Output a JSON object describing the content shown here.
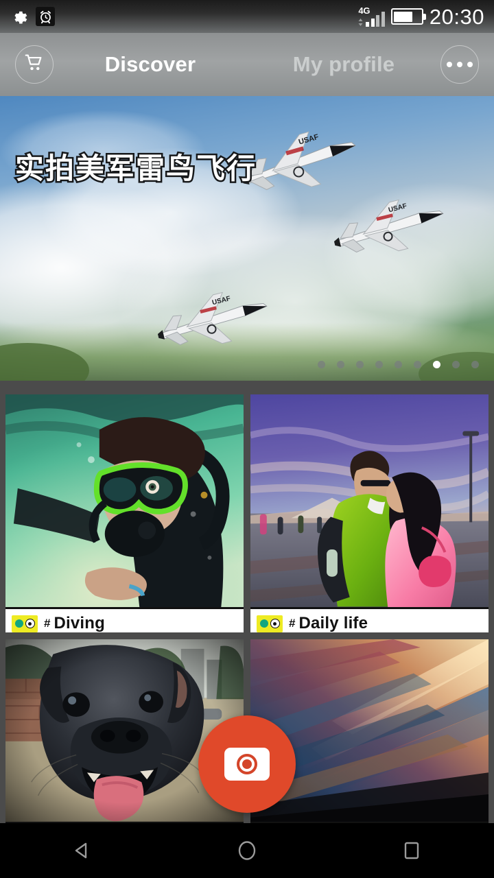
{
  "status_bar": {
    "time": "20:30",
    "network_label": "4G",
    "icons": [
      "settings-gear-icon",
      "alarm-clock-icon",
      "signal-bars-icon",
      "battery-icon"
    ],
    "battery_percent": 70
  },
  "app_bar": {
    "cart_icon": "shopping-cart-icon",
    "more_icon": "overflow-menu-icon",
    "tabs": [
      {
        "label": "Discover",
        "active": true
      },
      {
        "label": "My profile",
        "active": false
      }
    ]
  },
  "banner": {
    "title": "实拍美军雷鸟飞行",
    "pagination": {
      "total": 9,
      "active_index": 6
    }
  },
  "grid": {
    "cards": [
      {
        "tag": "Diving",
        "hash": "#",
        "badge_icon": "camera-tag-badge-icon"
      },
      {
        "tag": "Daily life",
        "hash": "#",
        "badge_icon": "camera-tag-badge-icon"
      },
      {
        "tag": "",
        "hash": "",
        "badge_icon": ""
      },
      {
        "tag": "",
        "hash": "",
        "badge_icon": ""
      }
    ]
  },
  "fab": {
    "icon": "camera-icon",
    "color": "#e0492a"
  },
  "nav_bar": {
    "buttons": [
      "back-nav-button",
      "home-nav-button",
      "recents-nav-button"
    ]
  },
  "colors": {
    "accent": "#e0492a",
    "badge_yellow": "#eeeb23",
    "badge_teal": "#12a67f",
    "grid_background": "#4b4b4b",
    "appbar_gray": "#9a9d9e"
  }
}
